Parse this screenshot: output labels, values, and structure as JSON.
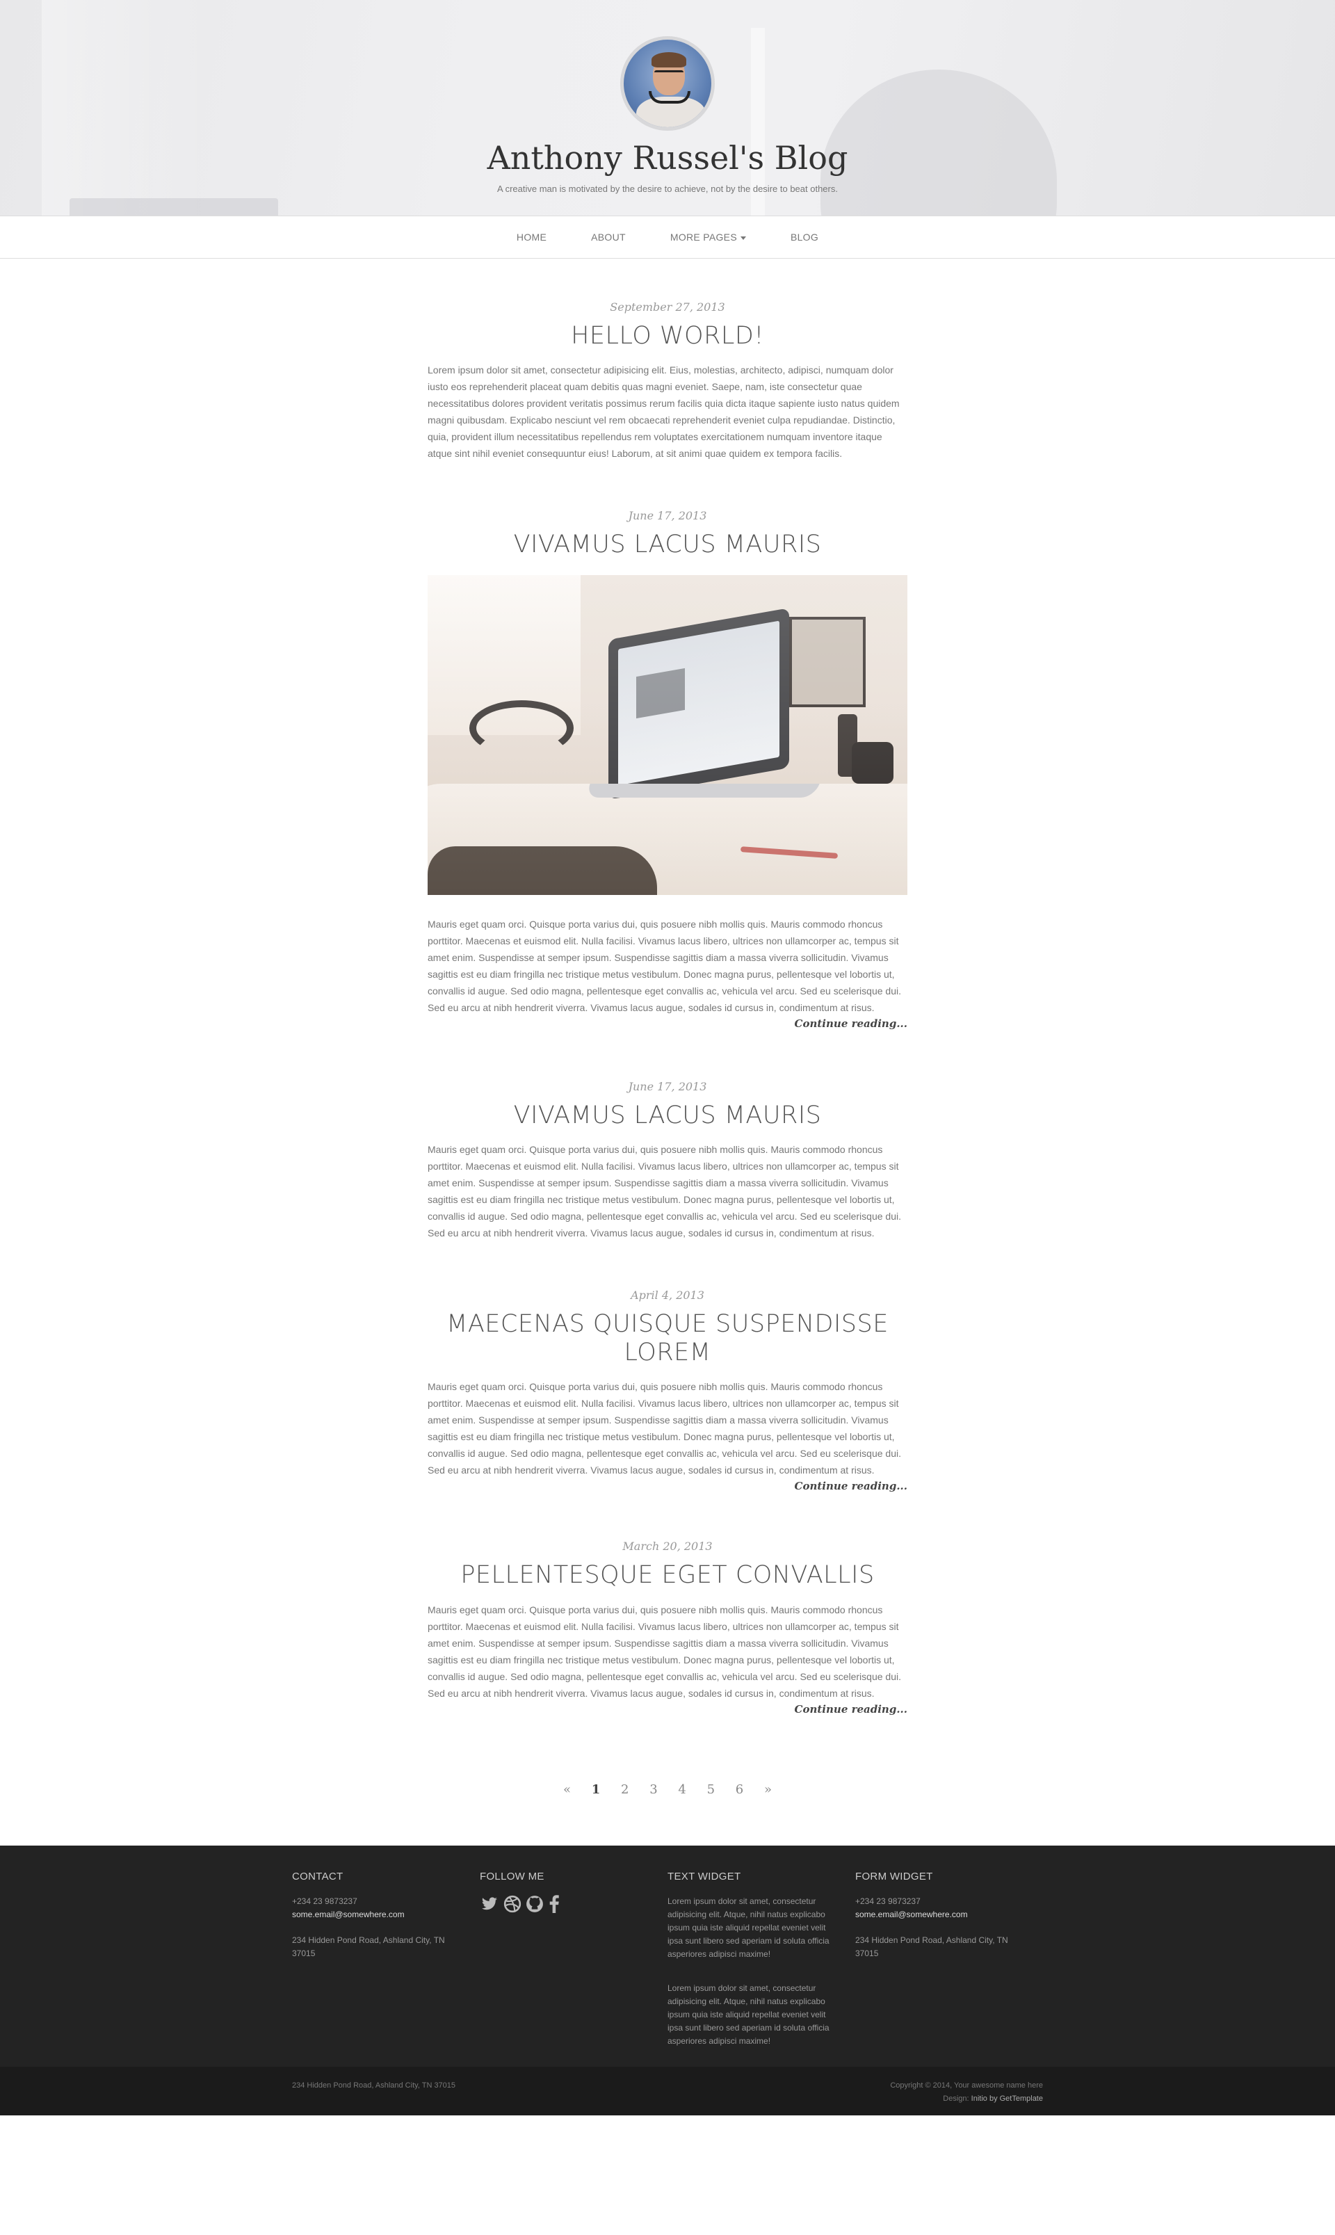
{
  "header": {
    "title": "Anthony Russel's Blog",
    "tagline": "A creative man is motivated by the desire to achieve, not by the desire to beat others."
  },
  "nav": {
    "items": [
      "HOME",
      "ABOUT",
      "MORE PAGES",
      "BLOG"
    ]
  },
  "posts": [
    {
      "date": "September 27, 2013",
      "title": "HELLO WORLD!",
      "body": "Lorem ipsum dolor sit amet, consectetur adipisicing elit. Eius, molestias, architecto, adipisci, numquam dolor iusto eos reprehenderit placeat quam debitis quas magni eveniet. Saepe, nam, iste consectetur quae necessitatibus dolores provident veritatis possimus rerum facilis quia dicta itaque sapiente iusto natus quidem magni quibusdam. Explicabo nesciunt vel rem obcaecati reprehenderit eveniet culpa repudiandae. Distinctio, quia, provident illum necessitatibus repellendus rem voluptates exercitationem numquam inventore itaque atque sint nihil eveniet consequuntur eius! Laborum, at sit animi quae quidem ex tempora facilis."
    },
    {
      "date": "June 17, 2013",
      "title": "VIVAMUS LACUS MAURIS",
      "body": "Mauris eget quam orci. Quisque porta varius dui, quis posuere nibh mollis quis. Mauris commodo rhoncus porttitor. Maecenas et euismod elit. Nulla facilisi. Vivamus lacus libero, ultrices non ullamcorper ac, tempus sit amet enim. Suspendisse at semper ipsum. Suspendisse sagittis diam a massa viverra sollicitudin. Vivamus sagittis est eu diam fringilla nec tristique metus vestibulum. Donec magna purus, pellentesque vel lobortis ut, convallis id augue. Sed odio magna, pellentesque eget convallis ac, vehicula vel arcu. Sed eu scelerisque dui. Sed eu arcu at nibh hendrerit viverra. Vivamus lacus augue, sodales id cursus in, condimentum at risus.",
      "readmore": "Continue reading..."
    },
    {
      "date": "June 17, 2013",
      "title": "VIVAMUS LACUS MAURIS",
      "body": "Mauris eget quam orci. Quisque porta varius dui, quis posuere nibh mollis quis. Mauris commodo rhoncus porttitor. Maecenas et euismod elit. Nulla facilisi. Vivamus lacus libero, ultrices non ullamcorper ac, tempus sit amet enim. Suspendisse at semper ipsum. Suspendisse sagittis diam a massa viverra sollicitudin. Vivamus sagittis est eu diam fringilla nec tristique metus vestibulum. Donec magna purus, pellentesque vel lobortis ut, convallis id augue. Sed odio magna, pellentesque eget convallis ac, vehicula vel arcu. Sed eu scelerisque dui. Sed eu arcu at nibh hendrerit viverra. Vivamus lacus augue, sodales id cursus in, condimentum at risus."
    },
    {
      "date": "April 4, 2013",
      "title": "MAECENAS QUISQUE SUSPENDISSE LOREM",
      "body": "Mauris eget quam orci. Quisque porta varius dui, quis posuere nibh mollis quis. Mauris commodo rhoncus porttitor. Maecenas et euismod elit. Nulla facilisi. Vivamus lacus libero, ultrices non ullamcorper ac, tempus sit amet enim. Suspendisse at semper ipsum. Suspendisse sagittis diam a massa viverra sollicitudin. Vivamus sagittis est eu diam fringilla nec tristique metus vestibulum. Donec magna purus, pellentesque vel lobortis ut, convallis id augue. Sed odio magna, pellentesque eget convallis ac, vehicula vel arcu. Sed eu scelerisque dui. Sed eu arcu at nibh hendrerit viverra. Vivamus lacus augue, sodales id cursus in, condimentum at risus.",
      "readmore": "Continue reading..."
    },
    {
      "date": "March 20, 2013",
      "title": "PELLENTESQUE EGET CONVALLIS",
      "body": "Mauris eget quam orci. Quisque porta varius dui, quis posuere nibh mollis quis. Mauris commodo rhoncus porttitor. Maecenas et euismod elit. Nulla facilisi. Vivamus lacus libero, ultrices non ullamcorper ac, tempus sit amet enim. Suspendisse at semper ipsum. Suspendisse sagittis diam a massa viverra sollicitudin. Vivamus sagittis est eu diam fringilla nec tristique metus vestibulum. Donec magna purus, pellentesque vel lobortis ut, convallis id augue. Sed odio magna, pellentesque eget convallis ac, vehicula vel arcu. Sed eu scelerisque dui. Sed eu arcu at nibh hendrerit viverra. Vivamus lacus augue, sodales id cursus in, condimentum at risus.",
      "readmore": "Continue reading..."
    }
  ],
  "pagination": {
    "prev": "«",
    "pages": [
      "1",
      "2",
      "3",
      "4",
      "5",
      "6"
    ],
    "active": "1",
    "next": "»"
  },
  "footer": {
    "contact": {
      "heading": "CONTACT",
      "phone": "+234 23 9873237",
      "email": "some.email@somewhere.com",
      "address": "234 Hidden Pond Road, Ashland City, TN 37015"
    },
    "follow": {
      "heading": "FOLLOW ME",
      "icons": [
        "twitter-icon",
        "dribbble-icon",
        "github-icon",
        "facebook-icon"
      ]
    },
    "text_widget": {
      "heading": "TEXT WIDGET",
      "p1": "Lorem ipsum dolor sit amet, consectetur adipisicing elit. Atque, nihil natus explicabo ipsum quia iste aliquid repellat eveniet velit ipsa sunt libero sed aperiam id soluta officia asperiores adipisci maxime!",
      "p2": "Lorem ipsum dolor sit amet, consectetur adipisicing elit. Atque, nihil natus explicabo ipsum quia iste aliquid repellat eveniet velit ipsa sunt libero sed aperiam id soluta officia asperiores adipisci maxime!"
    },
    "form_widget": {
      "heading": "FORM WIDGET",
      "phone": "+234 23 9873237",
      "email": "some.email@somewhere.com",
      "address": "234 Hidden Pond Road, Ashland City, TN 37015"
    },
    "bottom": {
      "address": "234 Hidden Pond Road, Ashland City, TN 37015",
      "copyright": "Copyright © 2014, Your awesome name here",
      "design_prefix": "Design:",
      "design_link": "Initio by GetTemplate"
    }
  },
  "colors": {
    "footer_bg": "#232323",
    "footer_bottom_bg": "#1b1b1b",
    "text": "#777777",
    "title": "#333333"
  }
}
